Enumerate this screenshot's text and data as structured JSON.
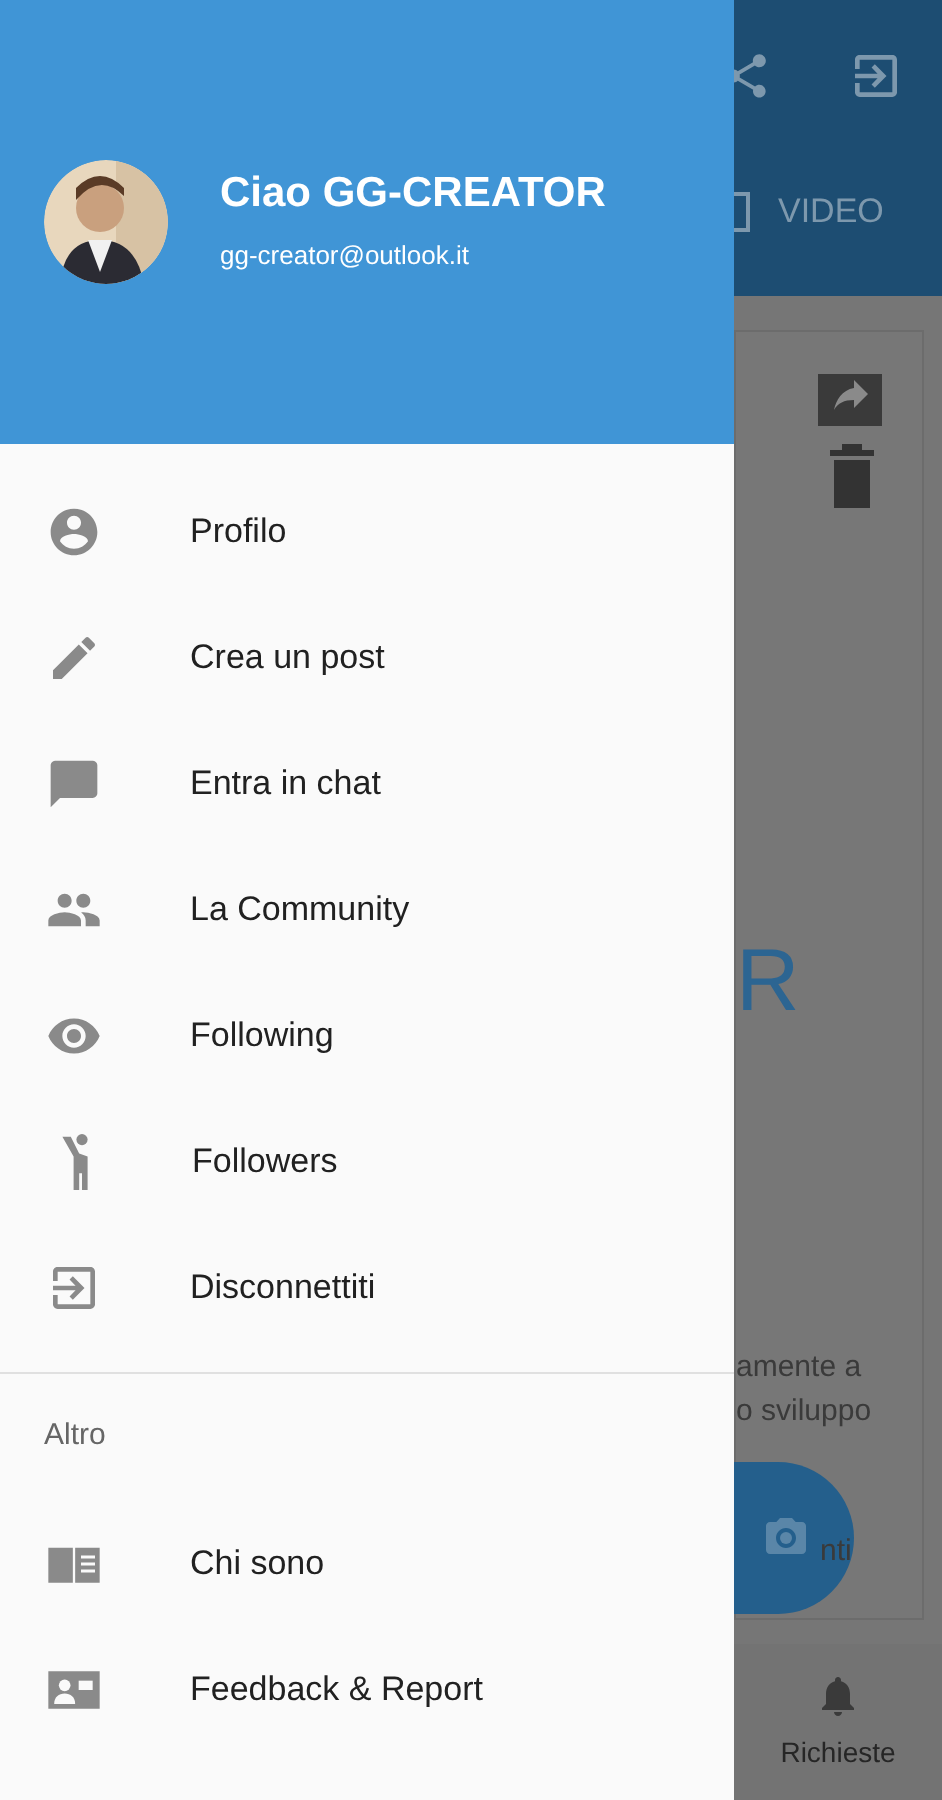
{
  "drawer": {
    "header": {
      "greeting": "Ciao GG-CREATOR",
      "email": "gg-creator@outlook.it"
    },
    "menu": [
      {
        "label": "Profilo"
      },
      {
        "label": "Crea un post"
      },
      {
        "label": "Entra in chat"
      },
      {
        "label": "La Community"
      },
      {
        "label": "Following"
      },
      {
        "label": "Followers"
      },
      {
        "label": "Disconnettiti"
      }
    ],
    "section_title": "Altro",
    "more_menu": [
      {
        "label": "Chi sono"
      },
      {
        "label": "Feedback & Report"
      }
    ]
  },
  "background_screen": {
    "tab": "VIDEO",
    "heading_fragment": "R",
    "text_fragments": [
      "amente a",
      "o sviluppo"
    ],
    "button_fragment": "nti",
    "bottom_nav": [
      {
        "label": "Richieste"
      }
    ]
  }
}
